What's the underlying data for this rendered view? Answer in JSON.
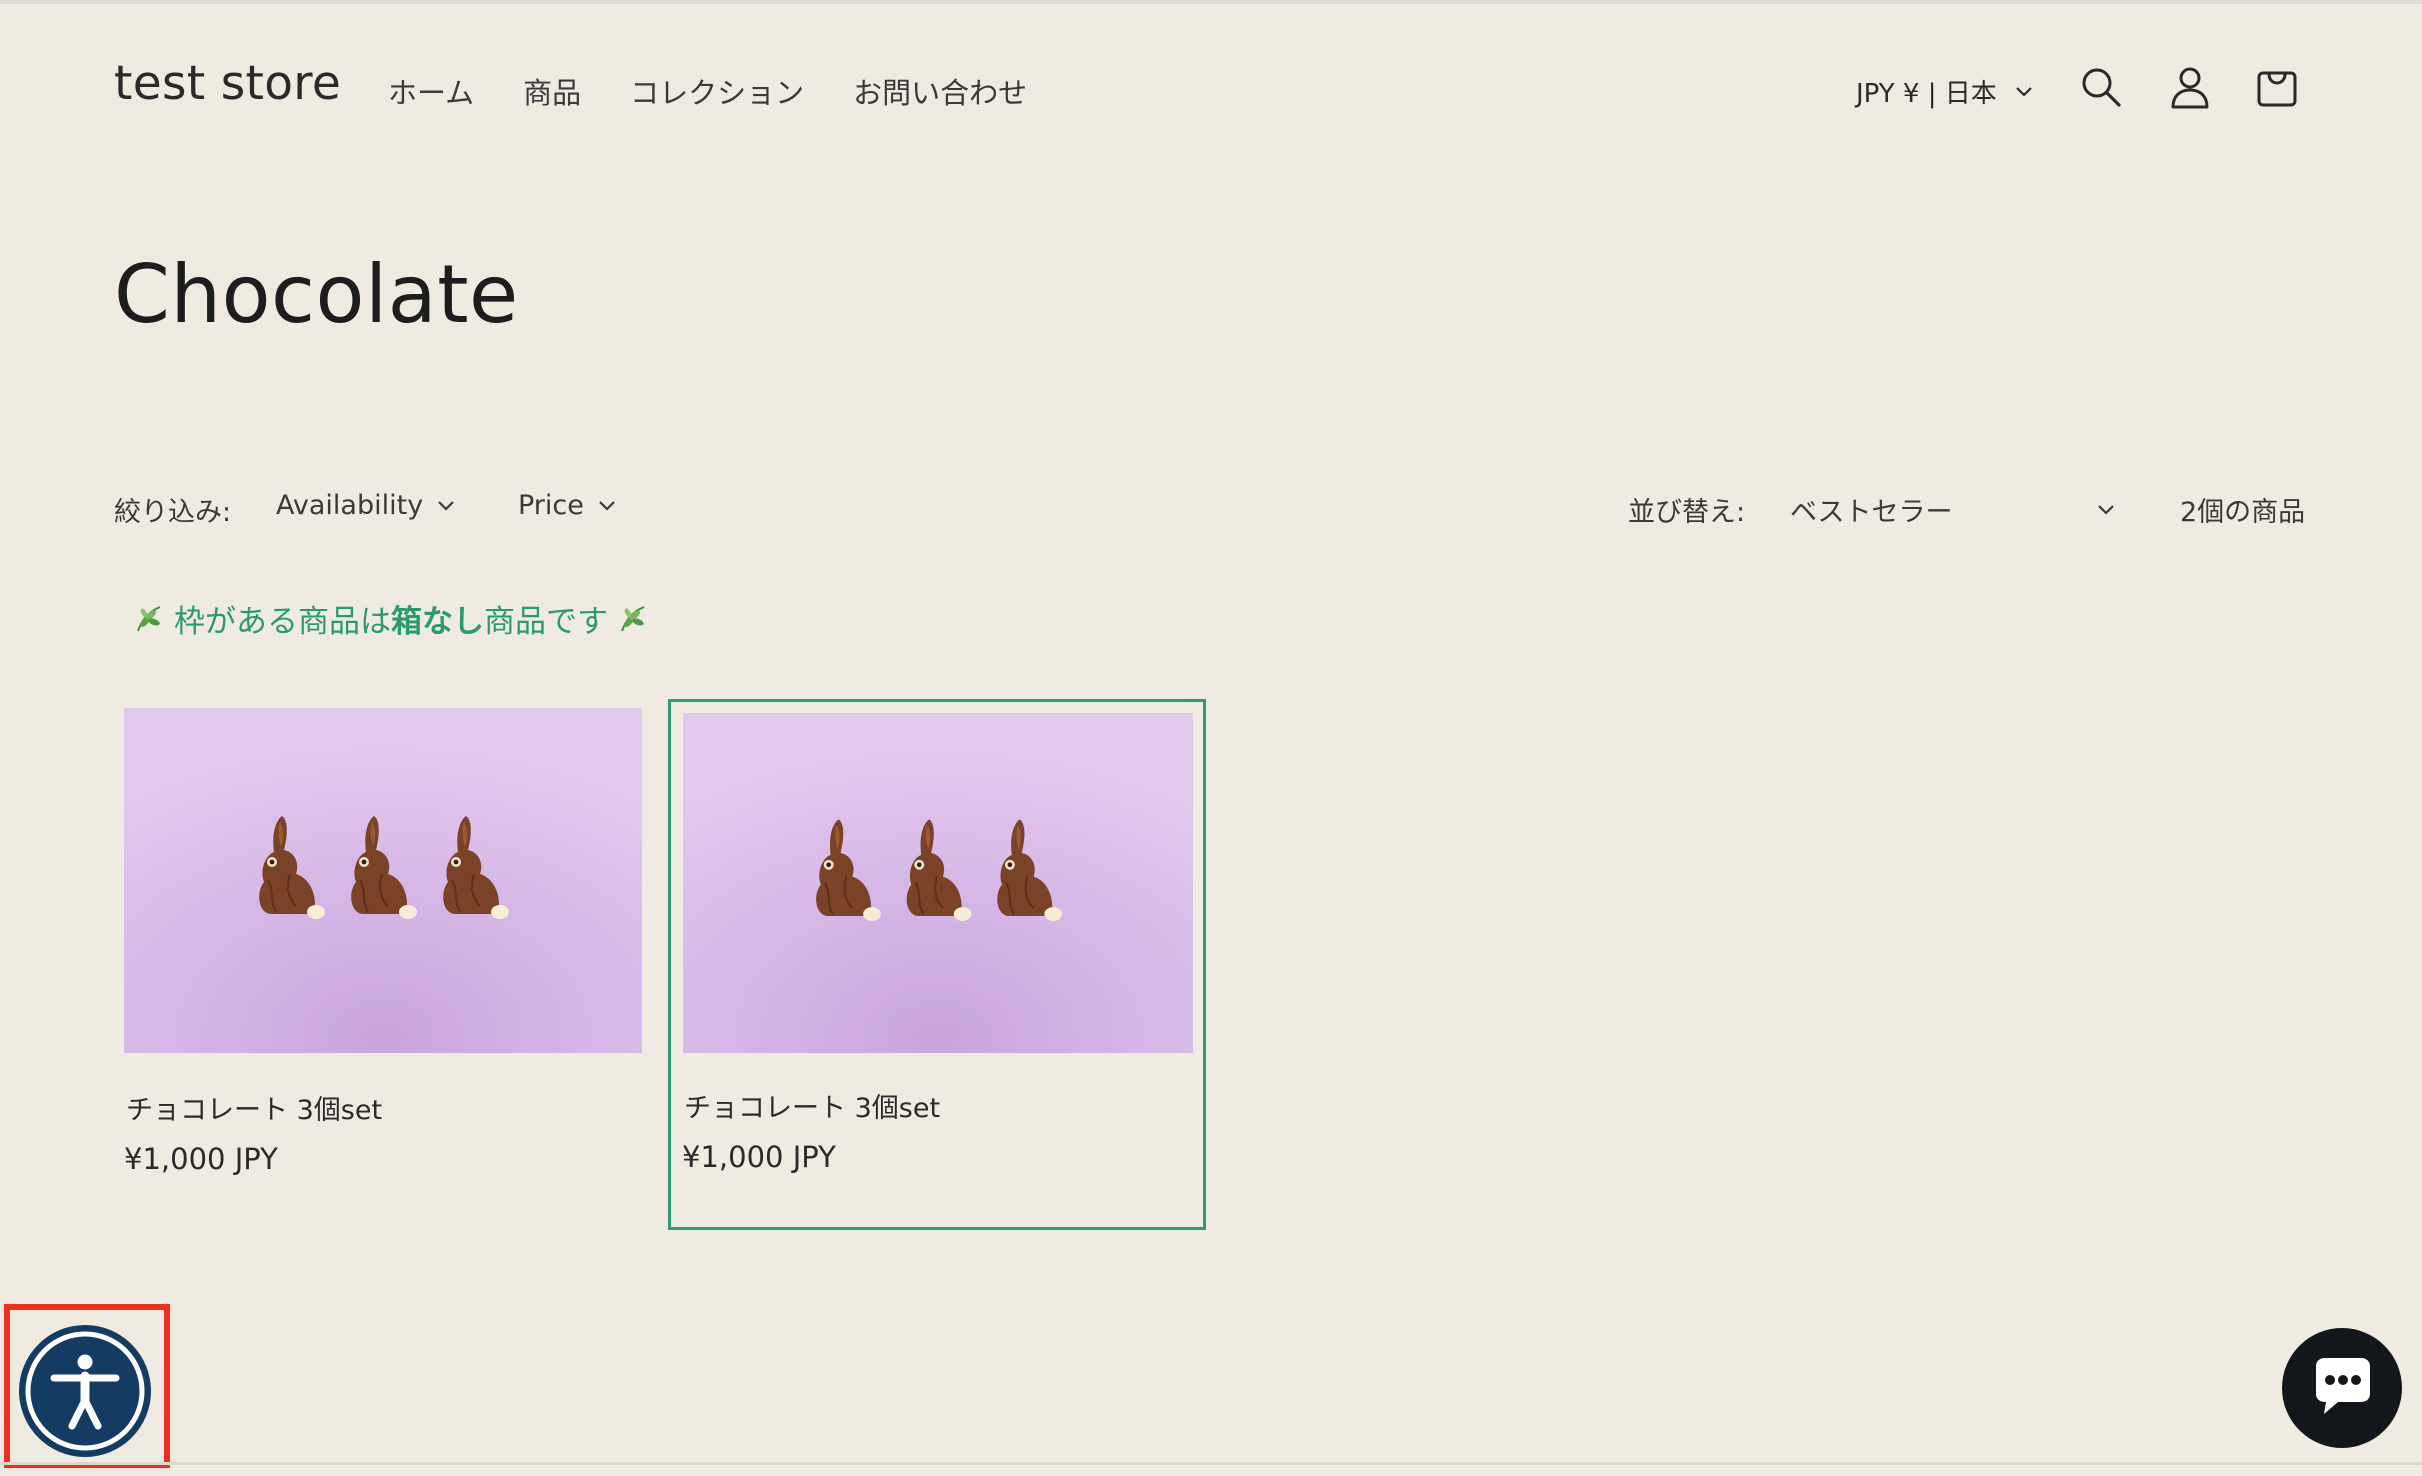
{
  "header": {
    "brand": "test store",
    "nav": [
      "ホーム",
      "商品",
      "コレクション",
      "お問い合わせ"
    ],
    "locale": "JPY ¥ | 日本",
    "icons": [
      "search-icon",
      "account-icon",
      "cart-icon"
    ]
  },
  "collection": {
    "title": "Chocolate"
  },
  "filters": {
    "label": "絞り込み:",
    "availability": "Availability",
    "price": "Price"
  },
  "sort": {
    "label": "並び替え:",
    "value": "ベストセラー"
  },
  "product_count": "2個の商品",
  "notice": {
    "before": "枠がある商品は",
    "bold": "箱なし",
    "after": "商品です"
  },
  "products": [
    {
      "name": "チョコレート 3個set",
      "price": "¥1,000 JPY",
      "boxed": false
    },
    {
      "name": "チョコレート 3個set",
      "price": "¥1,000 JPY",
      "boxed": true
    }
  ],
  "colors": {
    "background": "#efebe0",
    "accent_green": "#2c9a6e",
    "highlight_red": "#e8321c",
    "image_bg": "#dcbfe6",
    "chocolate": "#7a4226",
    "a11y_blue": "#143c63",
    "chat_dark": "#13171c"
  }
}
